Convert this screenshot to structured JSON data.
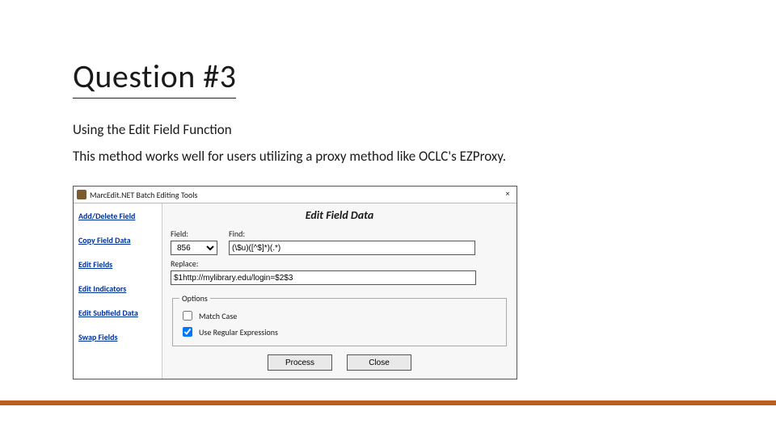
{
  "slide": {
    "title": "Question #3",
    "subtitle": "Using the Edit Field Function",
    "body": "This method works well for users utilizing a proxy method like OCLC's EZProxy."
  },
  "window": {
    "title": "MarcEdit.NET Batch Editing Tools",
    "close_glyph": "×",
    "sidebar": {
      "items": [
        "Add/Delete Field",
        "Copy Field Data",
        "Edit Fields",
        "Edit Indicators",
        "Edit Subfield Data",
        "Swap Fields"
      ]
    },
    "main": {
      "heading": "Edit Field Data",
      "field_label": "Field:",
      "field_value": "856",
      "find_label": "Find:",
      "find_value": "(\\$u)([^$]*)(.*)",
      "replace_label": "Replace:",
      "replace_value": "$1http://mylibrary.edu/login=$2$3",
      "options_legend": "Options",
      "match_case_label": "Match Case",
      "match_case_checked": false,
      "regex_label": "Use Regular Expressions",
      "regex_checked": true,
      "process_label": "Process",
      "close_label": "Close"
    }
  },
  "colors": {
    "accent_bar": "#bd5d1e",
    "link": "#003399"
  }
}
